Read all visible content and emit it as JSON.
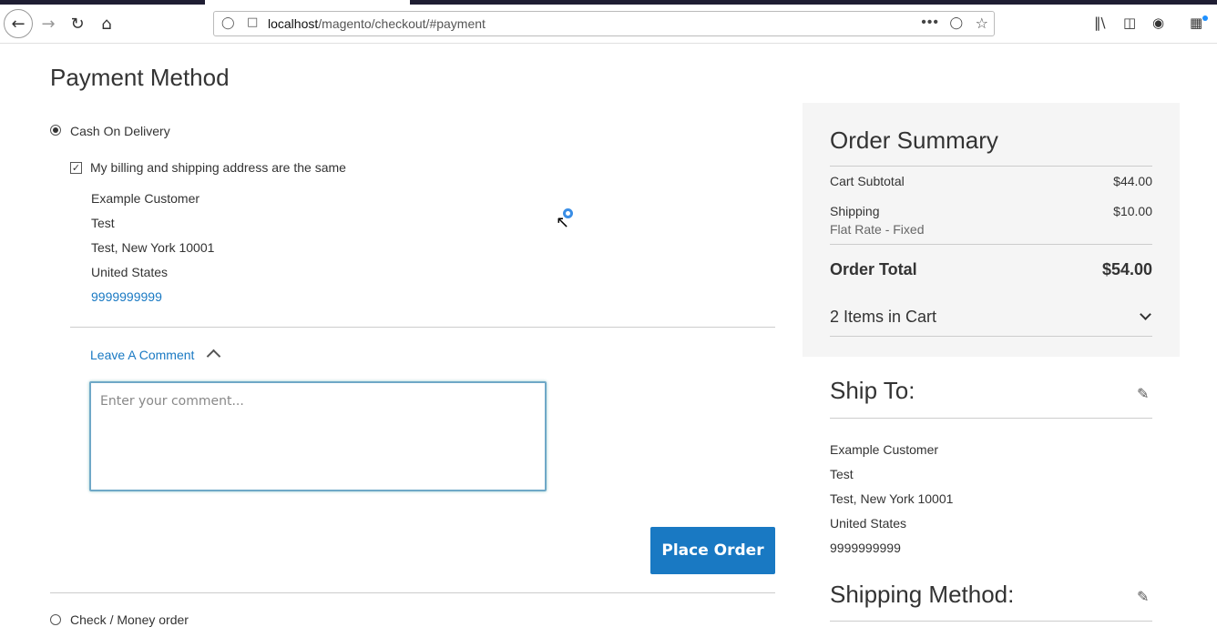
{
  "browser": {
    "url_host": "localhost",
    "url_path": "/magento/checkout/#payment",
    "icons": [
      "back-icon",
      "forward-icon",
      "reload-icon",
      "home-icon",
      "shield-icon",
      "page-icon",
      "more-icon",
      "pocket-icon",
      "star-icon",
      "library-icon",
      "sidebar-icon",
      "account-icon",
      "extensions-icon"
    ]
  },
  "payment": {
    "title": "Payment Method",
    "methods": [
      {
        "label": "Cash On Delivery",
        "selected": true
      },
      {
        "label": "Check / Money order",
        "selected": false
      }
    ],
    "same_address_label": "My billing and shipping address are the same",
    "billing_address": {
      "name": "Example Customer",
      "street": "Test",
      "city_line": "Test, New York 10001",
      "country": "United States",
      "phone": "9999999999"
    },
    "comment_toggle": "Leave A Comment",
    "comment_placeholder": "Enter your comment...",
    "place_order": "Place Order"
  },
  "summary": {
    "title": "Order Summary",
    "subtotal_label": "Cart Subtotal",
    "subtotal_value": "$44.00",
    "shipping_label": "Shipping",
    "shipping_method": "Flat Rate - Fixed",
    "shipping_value": "$10.00",
    "total_label": "Order Total",
    "total_value": "$54.00",
    "items_in_cart": "2 Items in Cart"
  },
  "ship_to": {
    "title": "Ship To:",
    "name": "Example Customer",
    "street": "Test",
    "city_line": "Test, New York 10001",
    "country": "United States",
    "phone": "9999999999"
  },
  "shipping_method": {
    "title": "Shipping Method:"
  },
  "colors": {
    "accent": "#1979c3",
    "summary_bg": "#f5f5f5"
  }
}
